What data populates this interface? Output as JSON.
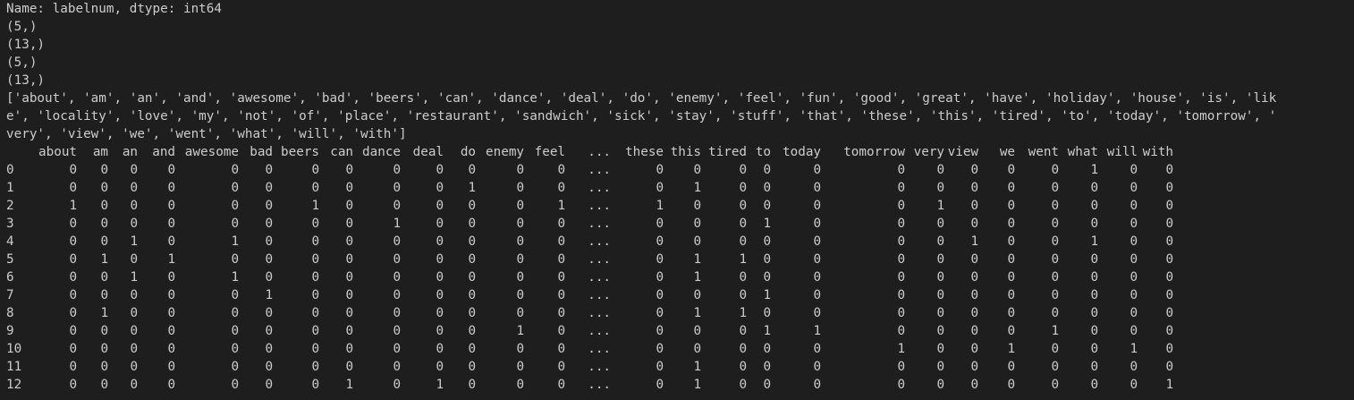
{
  "output": {
    "lines": [
      "Name: labelnum, dtype: int64",
      "(5,)",
      "(13,)",
      "(5,)",
      "(13,)",
      "['about', 'am', 'an', 'and', 'awesome', 'bad', 'beers', 'can', 'dance', 'deal', 'do', 'enemy', 'feel', 'fun', 'good', 'great', 'have', 'holiday', 'house', 'is', 'lik",
      "e', 'locality', 'love', 'my', 'not', 'of', 'place', 'restaurant', 'sandwich', 'sick', 'stay', 'stuff', 'that', 'these', 'this', 'tired', 'to', 'today', 'tomorrow', '",
      "very', 'view', 'we', 'went', 'what', 'will', 'with']"
    ]
  },
  "dataframe": {
    "columns": [
      "about",
      "am",
      "an",
      "and",
      "awesome",
      "bad",
      "beers",
      "can",
      "dance",
      "deal",
      "do",
      "enemy",
      "feel",
      "...",
      "these",
      "this",
      "tired",
      "to",
      "today",
      "tomorrow",
      "very",
      "view",
      "we",
      "went",
      "what",
      "will",
      "with"
    ],
    "index": [
      "0",
      "1",
      "2",
      "3",
      "4",
      "5",
      "6",
      "7",
      "8",
      "9",
      "10",
      "11",
      "12"
    ],
    "rows": [
      [
        "0",
        "0",
        "0",
        "0",
        "0",
        "0",
        "0",
        "0",
        "0",
        "0",
        "0",
        "0",
        "0",
        "...",
        "0",
        "0",
        "0",
        "0",
        "0",
        "0",
        "0",
        "0",
        "0",
        "0",
        "1",
        "0",
        "0"
      ],
      [
        "0",
        "0",
        "0",
        "0",
        "0",
        "0",
        "0",
        "0",
        "0",
        "0",
        "1",
        "0",
        "0",
        "...",
        "0",
        "1",
        "0",
        "0",
        "0",
        "0",
        "0",
        "0",
        "0",
        "0",
        "0",
        "0",
        "0"
      ],
      [
        "1",
        "0",
        "0",
        "0",
        "0",
        "0",
        "1",
        "0",
        "0",
        "0",
        "0",
        "0",
        "1",
        "...",
        "1",
        "0",
        "0",
        "0",
        "0",
        "0",
        "1",
        "0",
        "0",
        "0",
        "0",
        "0",
        "0"
      ],
      [
        "0",
        "0",
        "0",
        "0",
        "0",
        "0",
        "0",
        "0",
        "1",
        "0",
        "0",
        "0",
        "0",
        "...",
        "0",
        "0",
        "0",
        "1",
        "0",
        "0",
        "0",
        "0",
        "0",
        "0",
        "0",
        "0",
        "0"
      ],
      [
        "0",
        "0",
        "1",
        "0",
        "1",
        "0",
        "0",
        "0",
        "0",
        "0",
        "0",
        "0",
        "0",
        "...",
        "0",
        "0",
        "0",
        "0",
        "0",
        "0",
        "0",
        "1",
        "0",
        "0",
        "1",
        "0",
        "0"
      ],
      [
        "0",
        "1",
        "0",
        "1",
        "0",
        "0",
        "0",
        "0",
        "0",
        "0",
        "0",
        "0",
        "0",
        "...",
        "0",
        "1",
        "1",
        "0",
        "0",
        "0",
        "0",
        "0",
        "0",
        "0",
        "0",
        "0",
        "0"
      ],
      [
        "0",
        "0",
        "1",
        "0",
        "1",
        "0",
        "0",
        "0",
        "0",
        "0",
        "0",
        "0",
        "0",
        "...",
        "0",
        "1",
        "0",
        "0",
        "0",
        "0",
        "0",
        "0",
        "0",
        "0",
        "0",
        "0",
        "0"
      ],
      [
        "0",
        "0",
        "0",
        "0",
        "0",
        "1",
        "0",
        "0",
        "0",
        "0",
        "0",
        "0",
        "0",
        "...",
        "0",
        "0",
        "0",
        "1",
        "0",
        "0",
        "0",
        "0",
        "0",
        "0",
        "0",
        "0",
        "0"
      ],
      [
        "0",
        "1",
        "0",
        "0",
        "0",
        "0",
        "0",
        "0",
        "0",
        "0",
        "0",
        "0",
        "0",
        "...",
        "0",
        "1",
        "1",
        "0",
        "0",
        "0",
        "0",
        "0",
        "0",
        "0",
        "0",
        "0",
        "0"
      ],
      [
        "0",
        "0",
        "0",
        "0",
        "0",
        "0",
        "0",
        "0",
        "0",
        "0",
        "0",
        "1",
        "0",
        "...",
        "0",
        "0",
        "0",
        "1",
        "1",
        "0",
        "0",
        "0",
        "0",
        "1",
        "0",
        "0",
        "0"
      ],
      [
        "0",
        "0",
        "0",
        "0",
        "0",
        "0",
        "0",
        "0",
        "0",
        "0",
        "0",
        "0",
        "0",
        "...",
        "0",
        "0",
        "0",
        "0",
        "0",
        "1",
        "0",
        "0",
        "1",
        "0",
        "0",
        "1",
        "0"
      ],
      [
        "0",
        "0",
        "0",
        "0",
        "0",
        "0",
        "0",
        "0",
        "0",
        "0",
        "0",
        "0",
        "0",
        "...",
        "0",
        "1",
        "0",
        "0",
        "0",
        "0",
        "0",
        "0",
        "0",
        "0",
        "0",
        "0",
        "0"
      ],
      [
        "0",
        "0",
        "0",
        "0",
        "0",
        "0",
        "0",
        "1",
        "0",
        "1",
        "0",
        "0",
        "0",
        "...",
        "0",
        "1",
        "0",
        "0",
        "0",
        "0",
        "0",
        "0",
        "0",
        "0",
        "0",
        "0",
        "1"
      ]
    ]
  }
}
